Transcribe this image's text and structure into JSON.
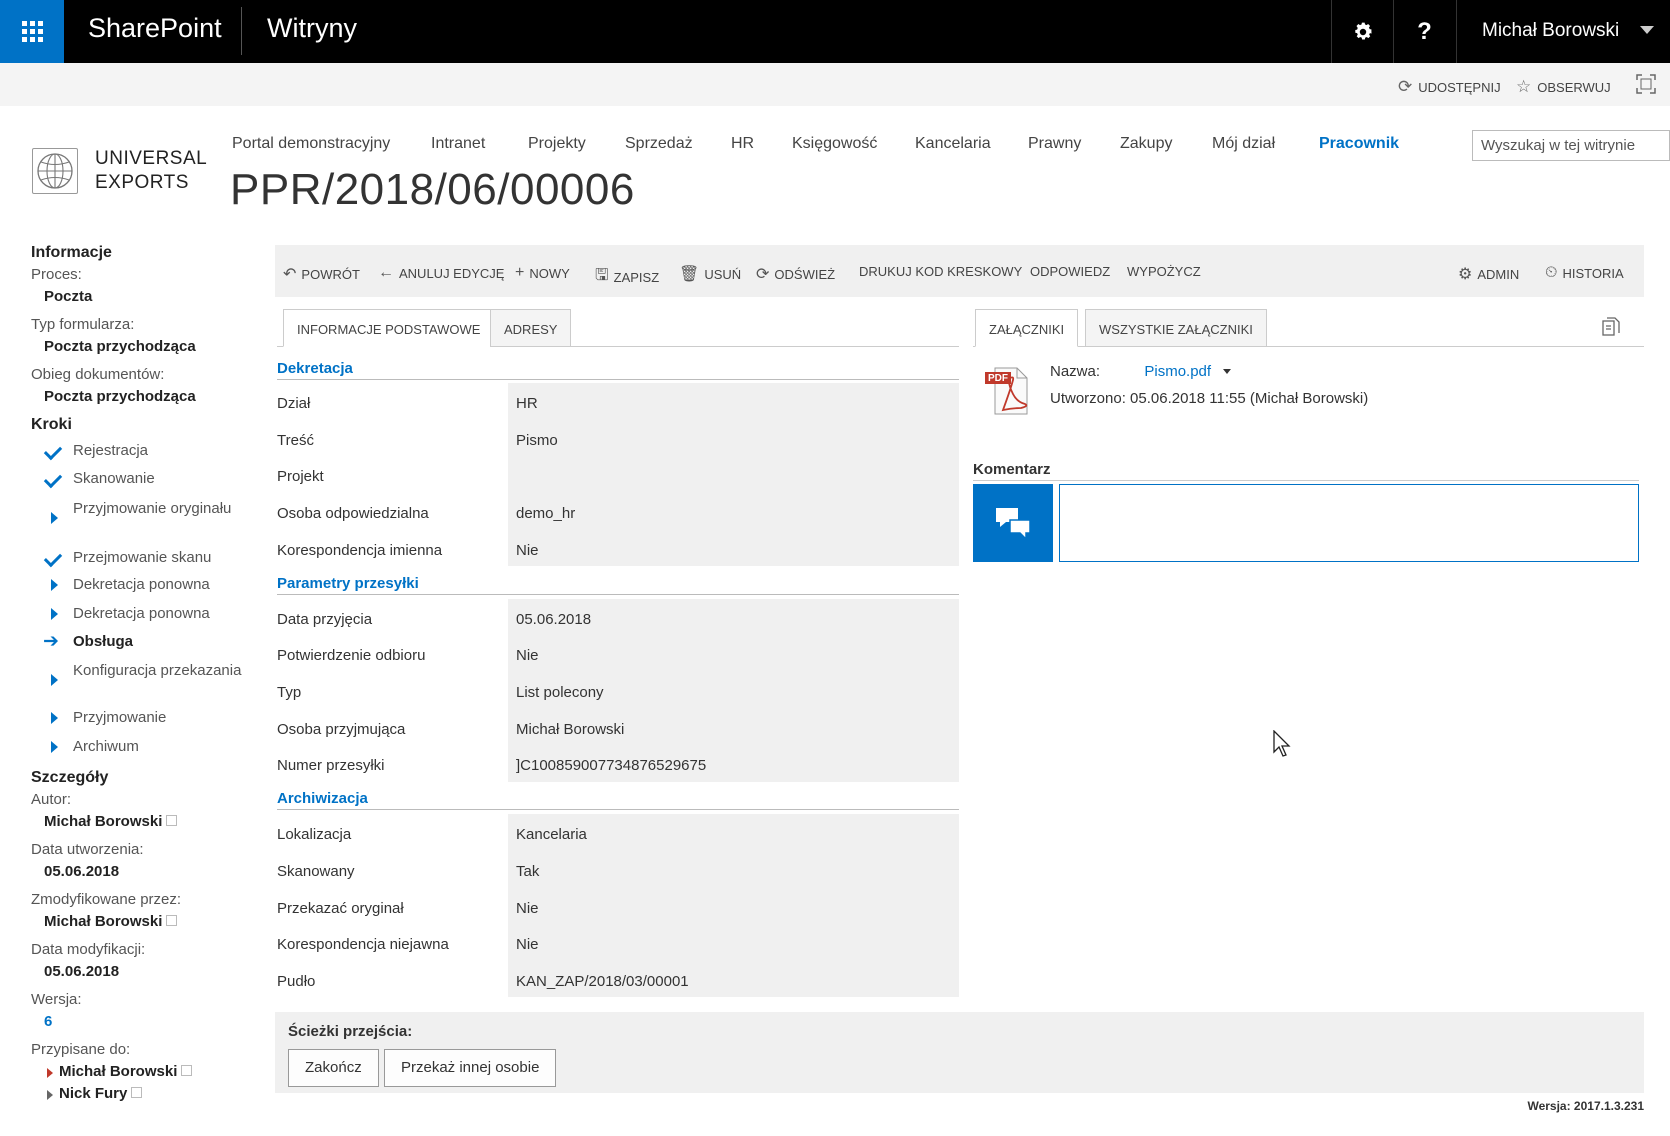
{
  "suitebar": {
    "brand": "SharePoint",
    "sites": "Witryny",
    "settings_icon": "gear-icon",
    "help_label": "?",
    "user": "Michał Borowski"
  },
  "actionbar": {
    "share": "UDOSTĘPNIJ",
    "follow": "OBSERWUJ"
  },
  "header": {
    "logo_line1": "UNIVERSAL",
    "logo_line2": "EXPORTS",
    "title": "PPR/2018/06/00006",
    "search_placeholder": "Wyszukaj w tej witrynie"
  },
  "topnav": [
    "Portal demonstracyjny",
    "Intranet",
    "Projekty",
    "Sprzedaż",
    "HR",
    "Księgowość",
    "Kancelaria",
    "Prawny",
    "Zakupy",
    "Mój dział",
    "Pracownik"
  ],
  "topnav_selected": "Pracownik",
  "left": {
    "info_heading": "Informacje",
    "process_label": "Proces:",
    "process_value": "Poczta",
    "formtype_label": "Typ formularza:",
    "formtype_value": "Poczta przychodząca",
    "flow_label": "Obieg dokumentów:",
    "flow_value": "Poczta przychodząca",
    "steps_heading": "Kroki",
    "steps": [
      {
        "label": "Rejestracja",
        "state": "done"
      },
      {
        "label": "Skanowanie",
        "state": "done"
      },
      {
        "label": "Przyjmowanie oryginału",
        "state": "pending"
      },
      {
        "label": "Przejmowanie skanu",
        "state": "done"
      },
      {
        "label": "Dekretacja ponowna",
        "state": "pending"
      },
      {
        "label": "Dekretacja ponowna",
        "state": "pending"
      },
      {
        "label": "Obsługa",
        "state": "current"
      },
      {
        "label": "Konfiguracja przekazania",
        "state": "pending"
      },
      {
        "label": "Przyjmowanie",
        "state": "pending"
      },
      {
        "label": "Archiwum",
        "state": "pending"
      }
    ],
    "details_heading": "Szczegóły",
    "author_label": "Autor:",
    "author_value": "Michał Borowski",
    "created_label": "Data utworzenia:",
    "created_value": "05.06.2018",
    "modby_label": "Zmodyfikowane przez:",
    "modby_value": "Michał Borowski",
    "moddate_label": "Data modyfikacji:",
    "moddate_value": "05.06.2018",
    "version_label": "Wersja:",
    "version_value": "6",
    "assigned_label": "Przypisane do:",
    "assigned": [
      "Michał Borowski",
      "Nick Fury"
    ]
  },
  "toolbar": {
    "back": "POWRÓT",
    "cancel": "ANULUJ EDYCJĘ",
    "new": "NOWY",
    "save": "ZAPISZ",
    "delete": "USUŃ",
    "refresh": "ODŚWIEŻ",
    "barcode": "DRUKUJ KOD KRESKOWY",
    "reply": "ODPOWIEDZ",
    "lend": "WYPOŻYCZ",
    "admin": "ADMIN",
    "history": "HISTORIA"
  },
  "tabs_left": [
    "INFORMACJE PODSTAWOWE",
    "ADRESY"
  ],
  "tabs_right": [
    "ZAŁĄCZNIKI",
    "WSZYSTKIE ZAŁĄCZNIKI"
  ],
  "sections": [
    {
      "title": "Dekretacja",
      "rows": [
        {
          "label": "Dział",
          "value": "HR"
        },
        {
          "label": "Treść",
          "value": "Pismo"
        },
        {
          "label": "Projekt",
          "value": ""
        },
        {
          "label": "Osoba odpowiedzialna",
          "value": "demo_hr"
        },
        {
          "label": "Korespondencja imienna",
          "value": "Nie"
        }
      ]
    },
    {
      "title": "Parametry przesyłki",
      "rows": [
        {
          "label": "Data przyjęcia",
          "value": "05.06.2018"
        },
        {
          "label": "Potwierdzenie odbioru",
          "value": "Nie"
        },
        {
          "label": "Typ",
          "value": "List polecony"
        },
        {
          "label": "Osoba przyjmująca",
          "value": "Michał Borowski"
        },
        {
          "label": "Numer przesyłki",
          "value": "]C100859007734876529675"
        }
      ]
    },
    {
      "title": "Archiwizacja",
      "rows": [
        {
          "label": "Lokalizacja",
          "value": "Kancelaria"
        },
        {
          "label": "Skanowany",
          "value": "Tak"
        },
        {
          "label": "Przekazać oryginał",
          "value": "Nie"
        },
        {
          "label": "Korespondencja niejawna",
          "value": "Nie"
        },
        {
          "label": "Pudło",
          "value": "KAN_ZAP/2018/03/00001"
        }
      ]
    }
  ],
  "attachment": {
    "name_label": "Nazwa:",
    "name_value": "Pismo.pdf",
    "created_label": "Utworzono:",
    "created_value": "05.06.2018 11:55 (Michał Borowski)",
    "pdf_badge": "PDF"
  },
  "comment_heading": "Komentarz",
  "paths": {
    "title": "Ścieżki przejścia:",
    "finish": "Zakończ",
    "forward": "Przekaż innej osobie"
  },
  "footer_version": "Wersja: 2017.1.3.231",
  "colors": {
    "accent": "#0072c6",
    "suitebar": "#000000"
  }
}
